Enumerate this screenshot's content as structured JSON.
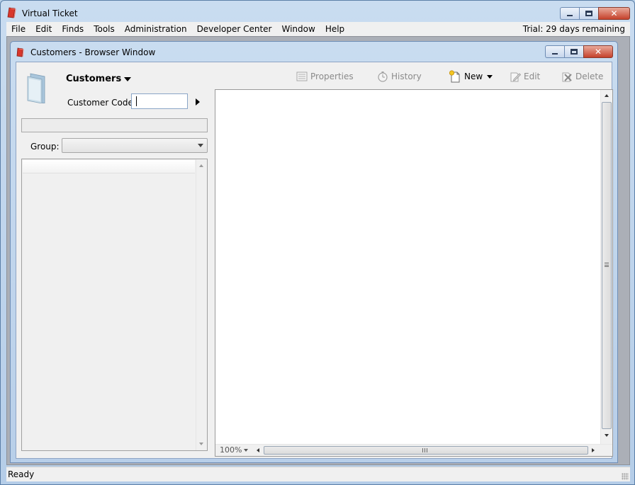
{
  "app": {
    "title": "Virtual Ticket",
    "trial_text": "Trial: 29 days remaining"
  },
  "menu": [
    "File",
    "Edit",
    "Finds",
    "Tools",
    "Administration",
    "Developer Center",
    "Window",
    "Help"
  ],
  "child_window": {
    "title": "Customers - Browser Window"
  },
  "left_panel": {
    "heading": "Customers",
    "customer_code_label": "Customer Code",
    "customer_code_value": "",
    "group_label": "Group:",
    "group_value": ""
  },
  "toolbar": {
    "properties": "Properties",
    "history": "History",
    "new": "New",
    "edit": "Edit",
    "delete": "Delete"
  },
  "browser": {
    "zoom": "100%"
  },
  "status": {
    "text": "Ready"
  },
  "icons": {
    "app": "ticket-icon",
    "folder": "folder-icon",
    "properties": "properties-icon",
    "history": "stopwatch-icon",
    "new": "new-doc-icon",
    "edit": "edit-pencil-icon",
    "delete": "delete-icon"
  },
  "colors": {
    "titlebar": "#c9dcf0",
    "close_button": "#c5412b",
    "disabled_text": "#8a8a8a"
  }
}
